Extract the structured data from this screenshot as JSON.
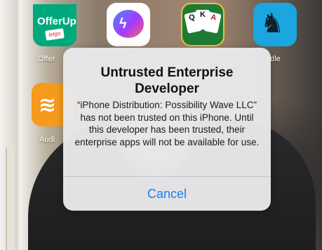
{
  "apps": {
    "offerup": {
      "label": "Offer",
      "icon_text": "OfferUp",
      "tag": "letgo",
      "icon": "offerup-icon"
    },
    "messenger": {
      "icon": "messenger-icon"
    },
    "solitaire": {
      "cards": [
        "Q",
        "K",
        "A"
      ],
      "icon": "solitaire-icon"
    },
    "kindle": {
      "label": "ndle",
      "icon": "kindle-icon"
    },
    "audible": {
      "label": "Audi",
      "icon": "audible-icon"
    }
  },
  "alert": {
    "title": "Untrusted Enterprise Developer",
    "message": "“iPhone Distribution: Possibility Wave LLC” has not been trusted on this iPhone. Until this developer has been trusted, their enterprise apps will not be available for use.",
    "cancel_label": "Cancel"
  },
  "colors": {
    "accent": "#1a7ff5",
    "alert_background": "#e8e8ea"
  }
}
